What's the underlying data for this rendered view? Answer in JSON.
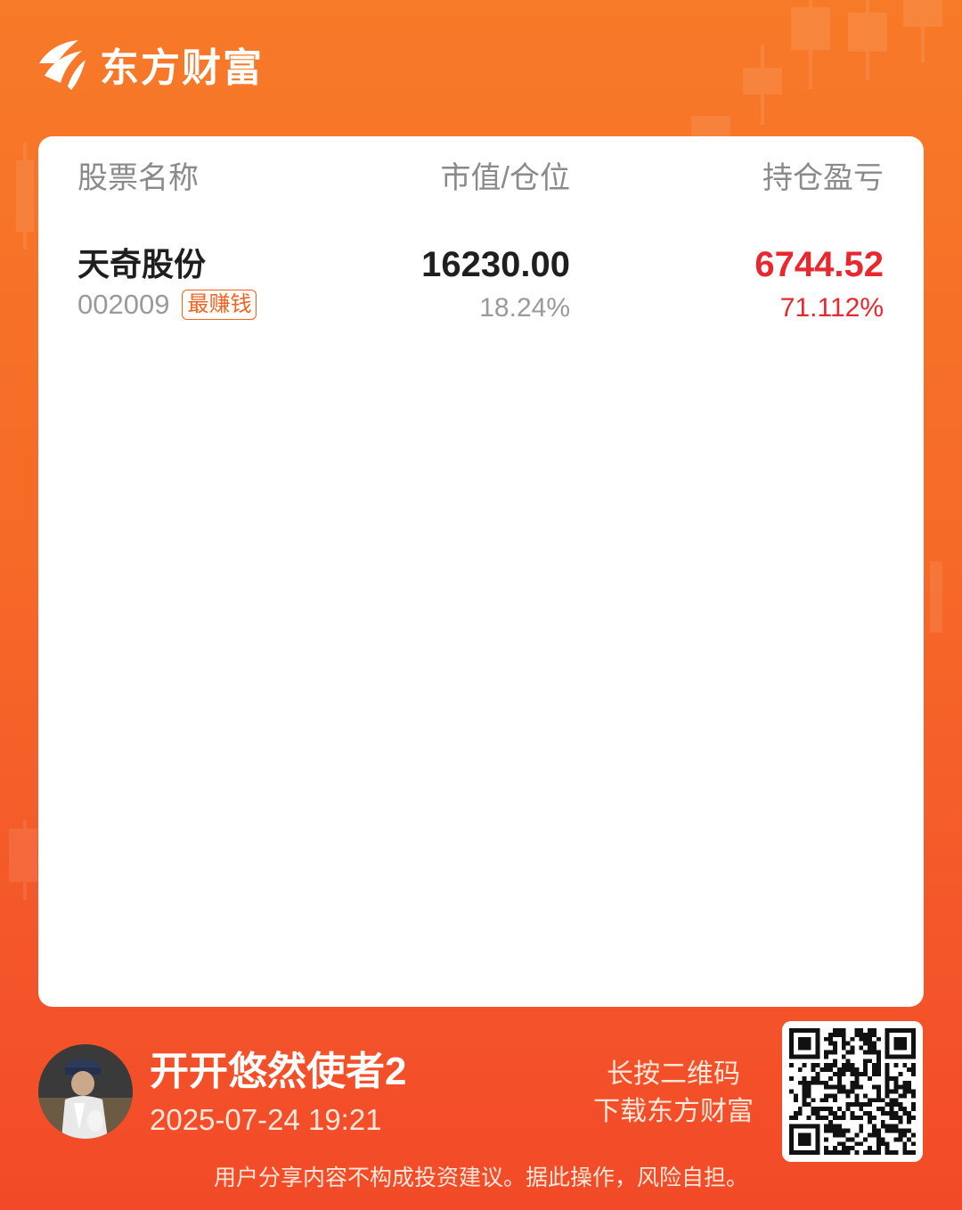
{
  "brand": {
    "name": "东方财富",
    "colors": {
      "background_top": "#f77a28",
      "background_bottom": "#f24a28",
      "profit_red": "#e8272e",
      "badge_orange": "#f0621e"
    }
  },
  "table": {
    "headers": {
      "name": "股票名称",
      "value_position": "市值/仓位",
      "profit_loss": "持仓盈亏"
    },
    "rows": [
      {
        "name": "天奇股份",
        "code": "002009",
        "badge": "最赚钱",
        "market_value": "16230.00",
        "position_pct": "18.24%",
        "pl_amount": "6744.52",
        "pl_pct": "71.112%"
      }
    ]
  },
  "footer": {
    "username": "开开悠然使者2",
    "timestamp": "2025-07-24 19:21",
    "qr_hint_line1": "长按二维码",
    "qr_hint_line2": "下载东方财富",
    "disclaimer": "用户分享内容不构成投资建议。据此操作，风险自担。"
  },
  "icons": {
    "logo": "eastmoney-logo-icon",
    "avatar": "user-avatar",
    "qr": "qr-code"
  }
}
